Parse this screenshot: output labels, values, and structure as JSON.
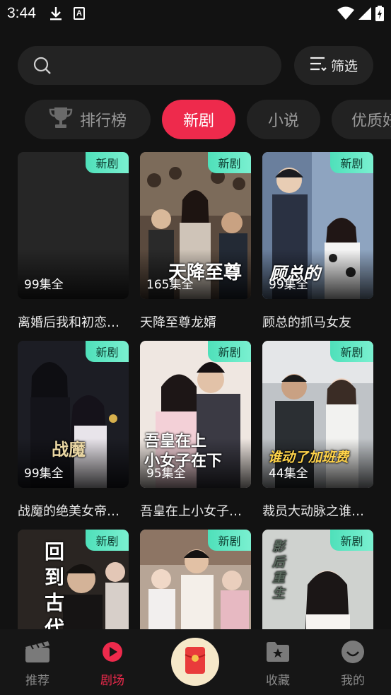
{
  "status_bar": {
    "time": "3:44",
    "a_icon_letter": "A"
  },
  "search": {
    "placeholder": "",
    "filter_label": "筛选"
  },
  "tabs": [
    {
      "label": "排行榜",
      "active": false
    },
    {
      "label": "新剧",
      "active": true
    },
    {
      "label": "小说",
      "active": false
    },
    {
      "label": "优质好剧",
      "active": false
    }
  ],
  "badge_label": "新剧",
  "cards": [
    {
      "title": "离婚后我和初恋…",
      "episodes": "99集全",
      "poster_text": ""
    },
    {
      "title": "天降至尊龙婿",
      "episodes": "165集全",
      "poster_text": "天降至尊"
    },
    {
      "title": "顾总的抓马女友",
      "episodes": "99集全",
      "poster_text": "顾总的"
    },
    {
      "title": "战魔的绝美女帝…",
      "episodes": "99集全",
      "poster_text": "战魔"
    },
    {
      "title": "吾皇在上小女子…",
      "episodes": "95集全",
      "poster_text": "吾皇在上\n小女子在下"
    },
    {
      "title": "裁员大动脉之谁…",
      "episodes": "44集全",
      "poster_text": "谁动了加班费"
    },
    {
      "title": "",
      "episodes": "",
      "poster_text": "回到古代"
    },
    {
      "title": "",
      "episodes": "",
      "poster_text": ""
    },
    {
      "title": "",
      "episodes": "",
      "poster_text": "影后重生"
    }
  ],
  "bottom_nav": {
    "home": "推荐",
    "theater": "剧场",
    "favorites": "收藏",
    "me": "我的"
  },
  "colors": {
    "accent": "#ee2a4c",
    "badge": "#5ee6c0",
    "background": "#121212"
  }
}
